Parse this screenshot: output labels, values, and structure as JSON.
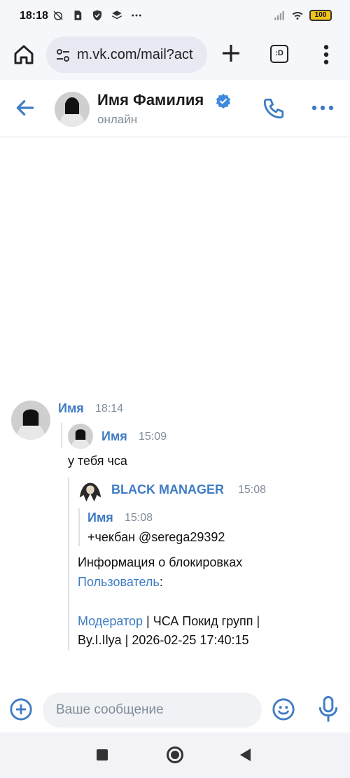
{
  "status_bar": {
    "time": "18:18",
    "battery": "100",
    "icons_left": [
      "alarm-off-icon",
      "sim-icon",
      "shield-icon",
      "layers-icon",
      "more-dots-icon"
    ],
    "icons_right": [
      "signal-icon",
      "wifi-icon",
      "battery-icon"
    ]
  },
  "browser": {
    "url": "m.vk.com/mail?act",
    "tabs_label": ":D"
  },
  "chat_header": {
    "name": "Имя Фамилия",
    "status": "онлайн"
  },
  "message": {
    "sender": "Имя",
    "time": "18:14",
    "forward_1": {
      "sender": "Имя",
      "time": "15:09",
      "text": "у тебя чса"
    },
    "forward_2": {
      "sender": "BLACK MANAGER",
      "time": "15:08",
      "forward_3": {
        "sender": "Имя",
        "time": "15:08",
        "text": "+чекбан @serega29392"
      },
      "block_title": "Информация о блокировках",
      "user_link": "Пользователь",
      "user_suffix": ":",
      "moderator_link": "Модератор",
      "moderator_suffix": " | ЧСА Покид групп |",
      "by_line": "By.I.Ilya | 2026-02-25 17:40:15"
    }
  },
  "composer": {
    "placeholder": "Ваше сообщение"
  },
  "colors": {
    "accent": "#3f7cc4",
    "secondary_text": "#818c99"
  }
}
